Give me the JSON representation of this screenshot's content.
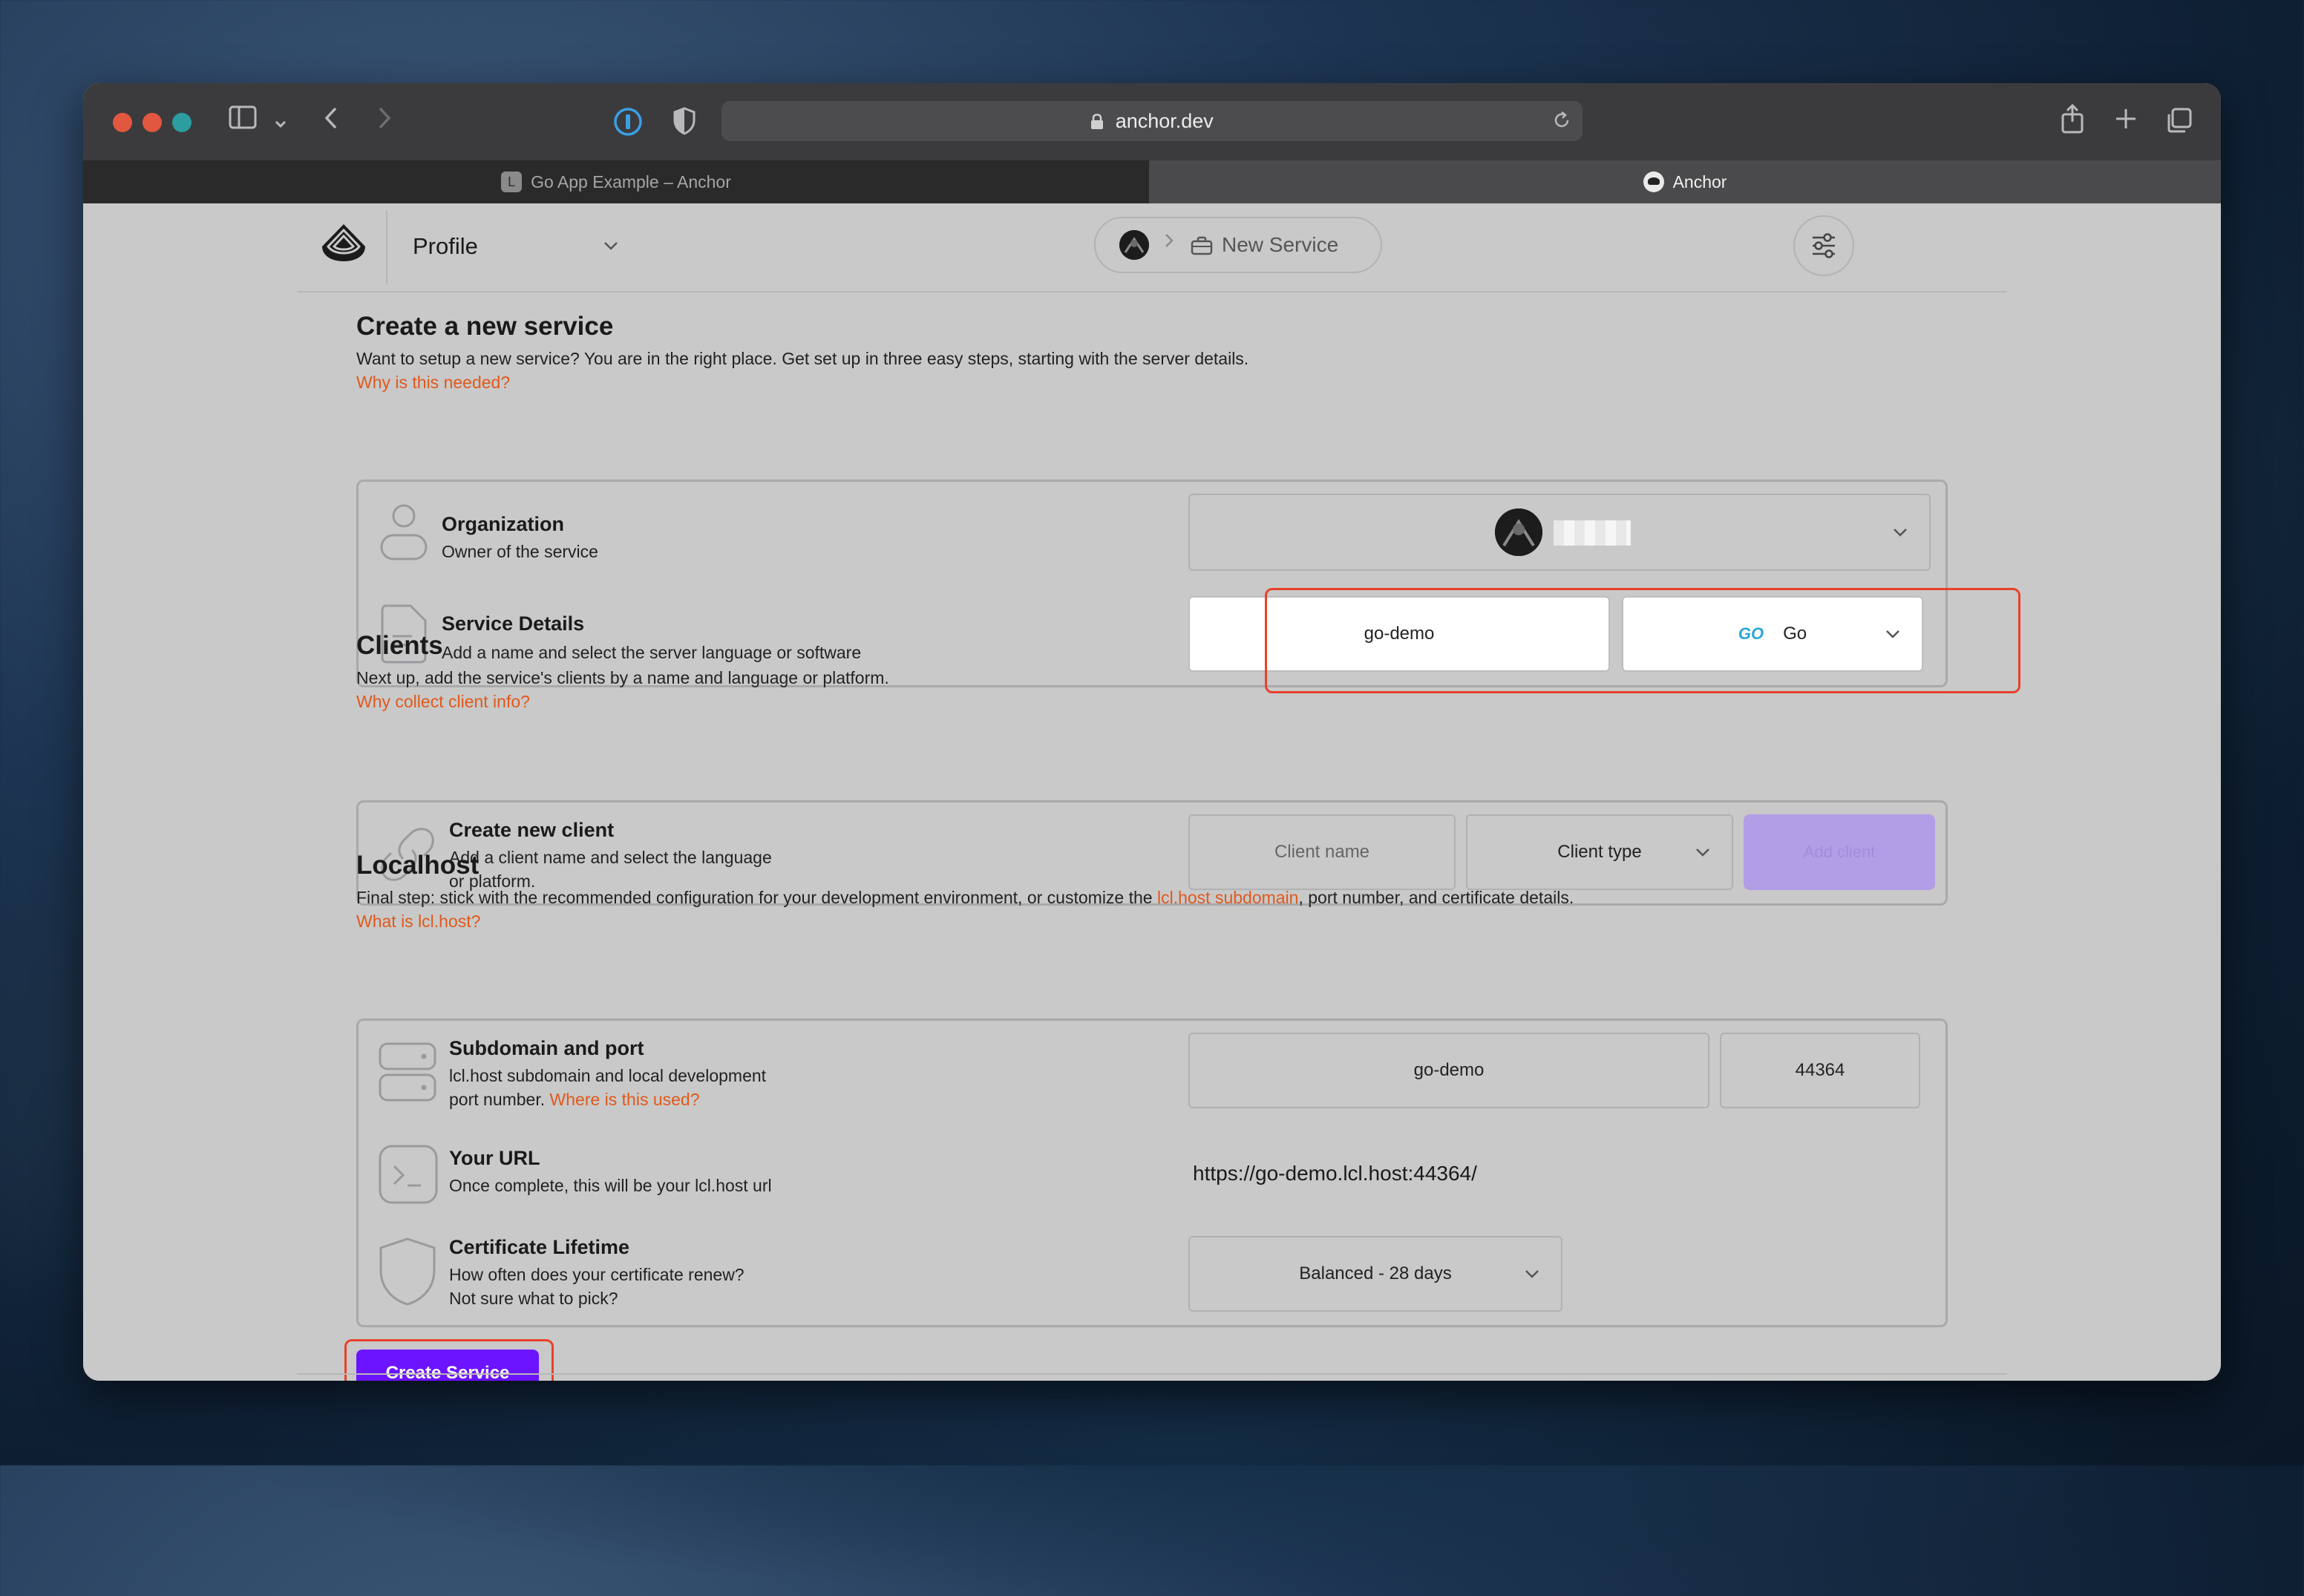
{
  "browser": {
    "url": "anchor.dev",
    "tabs": [
      {
        "label": "Go App Example – Anchor",
        "favicon": "L"
      },
      {
        "label": "Anchor"
      }
    ]
  },
  "header": {
    "profile_label": "Profile",
    "breadcrumb_current": "New Service"
  },
  "service": {
    "title": "Create a new service",
    "description": "Want to setup a new service? You are in the right place. Get set up in three easy steps, starting with the server details.",
    "link": "Why is this needed?",
    "organization": {
      "title": "Organization",
      "subtitle": "Owner of the service"
    },
    "details": {
      "title": "Service Details",
      "subtitle": "Add a name and select the server language or software",
      "name_value": "go-demo",
      "language_value": "Go",
      "language_badge": "GO"
    }
  },
  "clients": {
    "title": "Clients",
    "description": "Next up, add the service's clients by a name and language or platform.",
    "link": "Why collect client info?",
    "create": {
      "title": "Create new client",
      "subtitle_line1": "Add a client name and select the language",
      "subtitle_line2": "or platform.",
      "name_placeholder": "Client name",
      "type_placeholder": "Client type",
      "add_label": "Add client"
    }
  },
  "localhost": {
    "title": "Localhost",
    "desc_before": "Final step: stick with the recommended configuration for your development environment, or customize the ",
    "desc_link": "lcl.host subdomain",
    "desc_after": ", port number, and certificate details.",
    "link": "What is lcl.host?",
    "subdomain": {
      "title": "Subdomain and port",
      "subtitle_line1": "lcl.host subdomain and local development",
      "subtitle_line2": "port number. ",
      "subtitle_link": "Where is this used?",
      "subdomain_value": "go-demo",
      "port_value": "44364"
    },
    "url": {
      "title": "Your URL",
      "subtitle": "Once complete, this will be your lcl.host url",
      "value": "https://go-demo.lcl.host:44364/"
    },
    "cert": {
      "title": "Certificate Lifetime",
      "subtitle": "How often does your certificate renew?",
      "link": "Not sure what to pick?",
      "value": "Balanced - 28 days"
    }
  },
  "actions": {
    "create_service": "Create Service"
  },
  "colors": {
    "accent": "#6c14ff",
    "link": "#e0591c",
    "highlight": "#e8412a"
  }
}
